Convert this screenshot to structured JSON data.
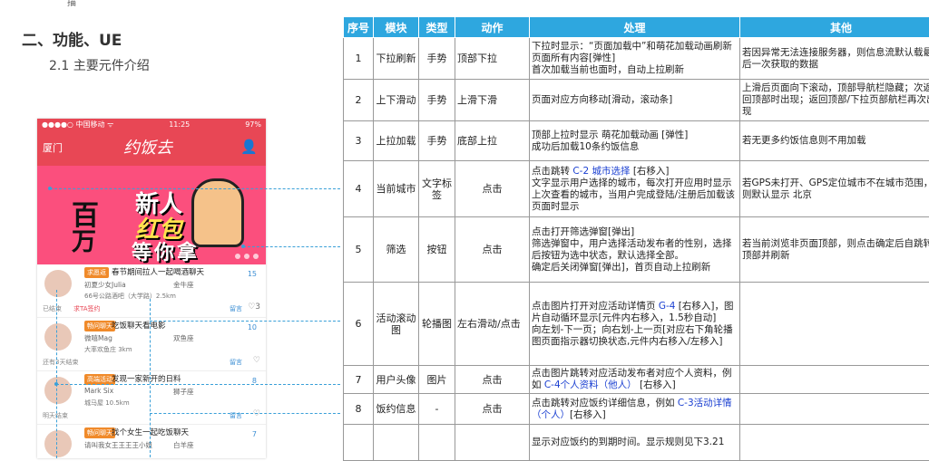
{
  "top_char": "描",
  "section_title": "二、功能、UE",
  "subsection_title": "2.1 主要元件介绍",
  "phone": {
    "status_left": "●●●●○ 中国移动 ᯤ",
    "status_time": "11:25",
    "status_right": "97%",
    "city": "厦门",
    "logo": "约饭去",
    "banner": {
      "line1": "百",
      "line2": "万",
      "line3": "新人",
      "line4": "红包",
      "line5": "等你拿"
    },
    "feed": [
      {
        "tag": "求愿返",
        "title": "春节期间拉人一起喝酒聊天",
        "name": "初夏少女Julia",
        "sign": "金牛座",
        "loc": "66号公路酒吧（大学路）2.5km",
        "foot": "已结束",
        "foot2": "求TA签约",
        "count": "15",
        "comment": "留言",
        "like": "3"
      },
      {
        "tag": "畅问聊天",
        "title": "吃饭聊天看电影",
        "name": "微嘻Mag",
        "sign": "双鱼座",
        "loc": "大率欢鱼庄 3km",
        "foot": "还有3天结束",
        "foot2": "",
        "count": "10",
        "comment": "留言",
        "like": ""
      },
      {
        "tag": "高端活动",
        "title": "发现一家新开的日料",
        "name": "Mark Six",
        "sign": "狮子座",
        "loc": "城马屋 10.5km",
        "foot": "明天结束",
        "foot2": "",
        "count": "8",
        "comment": "留言",
        "like": ""
      },
      {
        "tag": "畅问聊天",
        "title": "找个女生一起吃饭聊天",
        "name": "请叫我女王王王王小姐",
        "sign": "白羊座",
        "loc": "",
        "foot": "",
        "foot2": "",
        "count": "7",
        "comment": "",
        "like": ""
      }
    ]
  },
  "table": {
    "headers": [
      "序号",
      "模块",
      "类型",
      "动作",
      "处理",
      "其他"
    ],
    "rows": [
      {
        "no": "1",
        "module": "下拉刷新",
        "type": "手势",
        "action": "顶部下拉",
        "proc": "下拉时显示：“页面加载中”和萌花加载动画刷新页面所有内容[弹性]\n首次加载当前也面时，自动上拉刷新",
        "other": "若因异常无法连接服务器，则信息流默认载最后一次获取的数据"
      },
      {
        "no": "2",
        "module": "上下滑动",
        "type": "手势",
        "action": "上滑下滑",
        "proc": "页面对应方向移动[滑动，滚动条]",
        "other": "上滑后页面向下滚动，顶部导航栏隐藏；次返回顶部时出现；返回顶部/下拉页部航栏再次出现"
      },
      {
        "no": "3",
        "module": "上拉加载",
        "type": "手势",
        "action": "底部上拉",
        "proc": "顶部上拉时显示 萌花加载动画 [弹性]\n成功后加载10条约饭信息",
        "other": "若无更多约饭信息则不用加载"
      },
      {
        "no": "4",
        "module": "当前城市",
        "type": "文字标签",
        "action": "点击",
        "proc_a": "点击跳转 ",
        "proc_link": "C-2 城市选择",
        "proc_b": " [右移入]\n文字显示用户选择的城市，每次打开应用时显示上次查看的城市，当用户完成登陆/注册后加载该页面时显示",
        "other": "若GPS未打开、GPS定位城市不在城市范围，则默认显示 北京"
      },
      {
        "no": "5",
        "module": "筛选",
        "type": "按钮",
        "action": "点击",
        "proc": "点击打开筛选弹窗[弹出]\n筛选弹窗中，用户选择活动发布者的性别，选择后按钮为选中状态，默认选择全部。\n确定后关闭弹窗[弹出]，首页自动上拉刷新",
        "other": "若当前浏览非页面顶部，则点击确定后自跳转顶部并刷新"
      },
      {
        "no": "6",
        "module": "活动滚动图",
        "type": "轮播图",
        "action": "左右滑动/点击",
        "proc_a": "点击图片打开对应活动详情页 ",
        "proc_link": "G-4",
        "proc_b": " [右移入]，图片自动循环显示[元件内右移入，1.5秒自动]\n向左划-下一页；向右划-上一页[对应右下角轮播图页面指示器切换状态,元件内右移入/左移入]",
        "other": ""
      },
      {
        "no": "7",
        "module": "用户头像",
        "type": "图片",
        "action": "点击",
        "proc_a": "点击图片跳转对应活动发布者对应个人资料，例如 ",
        "proc_link": "C-4个人资料（他人）",
        "proc_b": " [右移入]",
        "other": ""
      },
      {
        "no": "8",
        "module": "饭约信息",
        "type": "-",
        "action": "点击",
        "proc_a": "点击跳转对应饭约详细信息，例如 ",
        "proc_link": "C-3活动详情（个人）",
        "proc_b": "[右移入]",
        "other": ""
      },
      {
        "no": "",
        "module": "",
        "type": "",
        "action": "",
        "proc": "显示对应饭约的到期时间。显示规则见下3.21",
        "other": ""
      }
    ]
  },
  "colors": {
    "header_bg": "#2ea7df",
    "app_red": "#e84755",
    "link": "#1a3fd1",
    "connector": "#3aa0d8"
  }
}
